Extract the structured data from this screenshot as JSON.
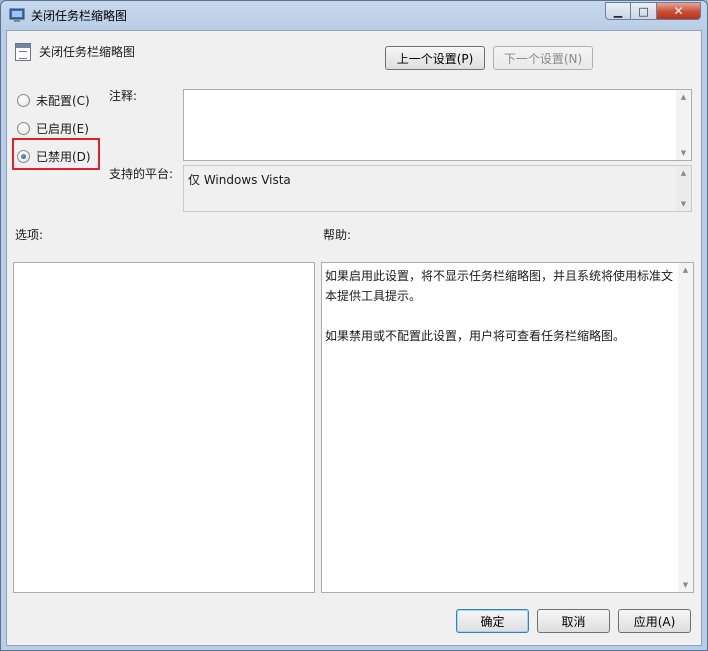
{
  "window": {
    "title": "关闭任务栏缩略图",
    "controls": {
      "minimize": "▁",
      "maximize": "□",
      "close": "✕"
    }
  },
  "header": {
    "title": "关闭任务栏缩略图",
    "prev_button": "上一个设置(P)",
    "next_button": "下一个设置(N)"
  },
  "radios": [
    {
      "label": "未配置(C)",
      "checked": false
    },
    {
      "label": "已启用(E)",
      "checked": false
    },
    {
      "label": "已禁用(D)",
      "checked": true
    }
  ],
  "comment": {
    "label": "注释:",
    "value": ""
  },
  "platform": {
    "label": "支持的平台:",
    "value": "仅 Windows Vista"
  },
  "options": {
    "label": "选项:"
  },
  "help": {
    "label": "帮助:",
    "text": "如果启用此设置，将不显示任务栏缩略图，并且系统将使用标准文本提供工具提示。\n\n如果禁用或不配置此设置，用户将可查看任务栏缩略图。"
  },
  "footer": {
    "ok_button": "确定",
    "cancel_button": "取消",
    "apply_button": "应用(A)"
  },
  "colors": {
    "highlight": "#e0202a",
    "accent": "#3c7fb1"
  }
}
